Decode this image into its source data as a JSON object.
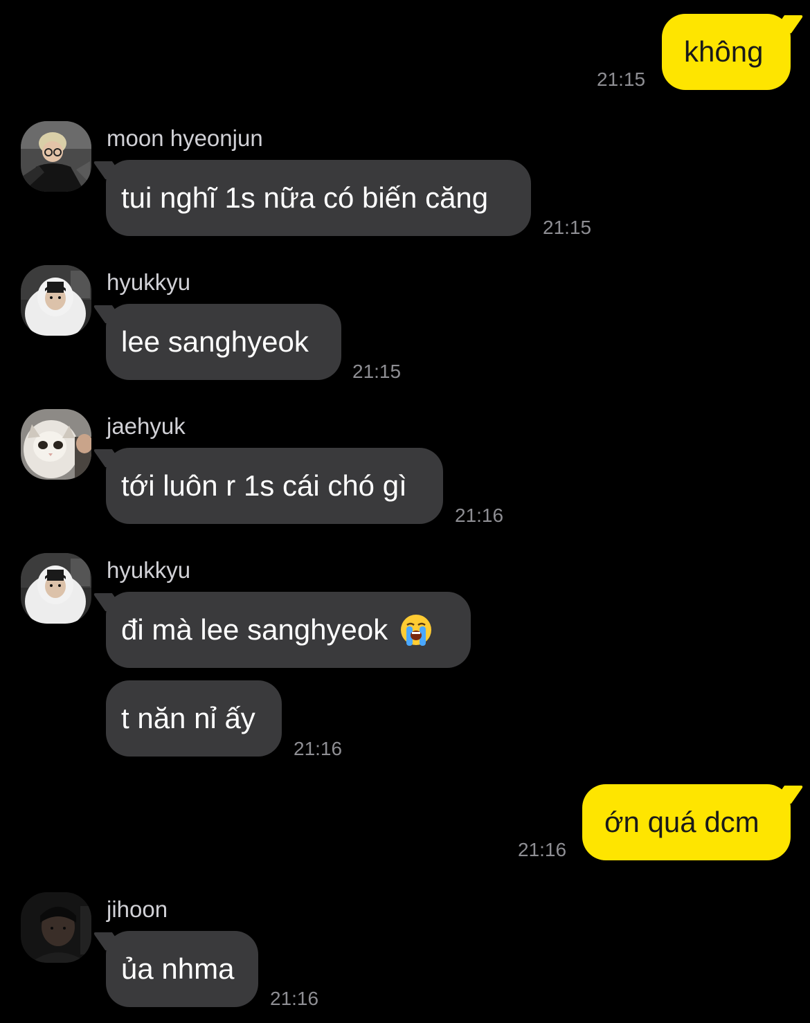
{
  "colors": {
    "background": "#000000",
    "my_bubble": "#fee500",
    "other_bubble": "#3a3a3c",
    "timestamp": "#8e8e93",
    "sender_name": "#d1d1d6"
  },
  "messages": [
    {
      "sender": "",
      "text": "không",
      "time": "21:15",
      "outgoing": true
    },
    {
      "sender": "moon hyeonjun",
      "avatar": "avatar-moon-hyeonjun",
      "text": "tui nghĩ 1s nữa có biến căng",
      "time": "21:15",
      "outgoing": false
    },
    {
      "sender": "hyukkyu",
      "avatar": "avatar-hyukkyu",
      "text": "lee sanghyeok",
      "time": "21:15",
      "outgoing": false
    },
    {
      "sender": "jaehyuk",
      "avatar": "avatar-jaehyuk",
      "text": "tới luôn r 1s cái chó gì",
      "time": "21:16",
      "outgoing": false
    },
    {
      "sender": "hyukkyu",
      "avatar": "avatar-hyukkyu",
      "text": "đi mà lee sanghyeok",
      "emoji": "loudly-crying-face-emoji",
      "time": "",
      "outgoing": false
    },
    {
      "sender": "",
      "text": "t năn nỉ ấy",
      "time": "21:16",
      "outgoing": false
    },
    {
      "sender": "",
      "text": "ớn quá dcm",
      "time": "21:16",
      "outgoing": true
    },
    {
      "sender": "jihoon",
      "avatar": "avatar-jihoon",
      "text": "ủa nhma",
      "time": "21:16",
      "outgoing": false
    }
  ]
}
